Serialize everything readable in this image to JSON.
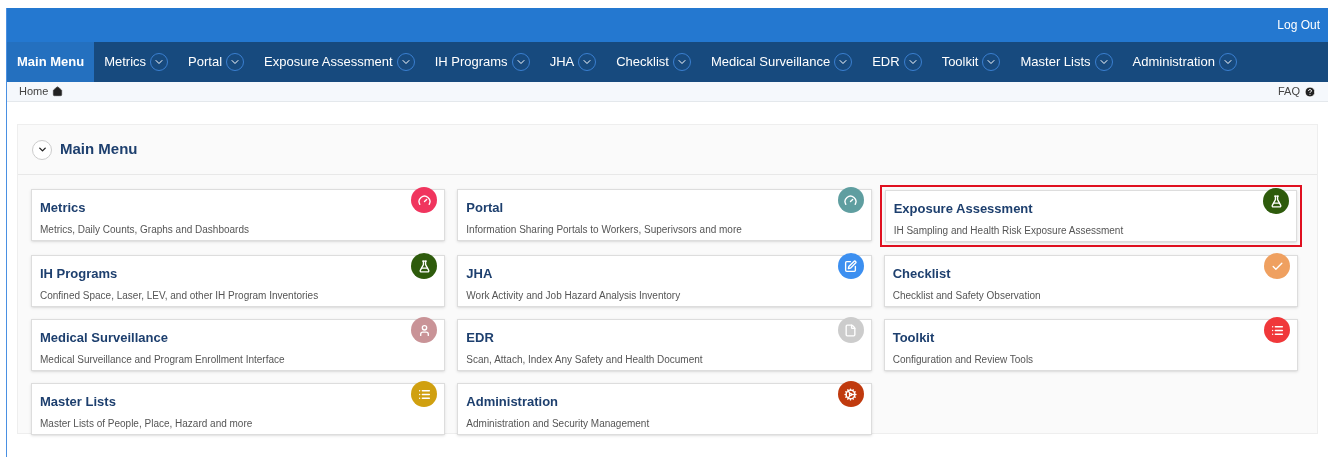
{
  "top_bar": {
    "logout": "Log Out"
  },
  "nav": [
    {
      "label": "Main Menu",
      "selected": true,
      "dropdown": false
    },
    {
      "label": "Metrics",
      "selected": false,
      "dropdown": true
    },
    {
      "label": "Portal",
      "selected": false,
      "dropdown": true
    },
    {
      "label": "Exposure Assessment",
      "selected": false,
      "dropdown": true
    },
    {
      "label": "IH Programs",
      "selected": false,
      "dropdown": true
    },
    {
      "label": "JHA",
      "selected": false,
      "dropdown": true
    },
    {
      "label": "Checklist",
      "selected": false,
      "dropdown": true
    },
    {
      "label": "Medical Surveillance",
      "selected": false,
      "dropdown": true
    },
    {
      "label": "EDR",
      "selected": false,
      "dropdown": true
    },
    {
      "label": "Toolkit",
      "selected": false,
      "dropdown": true
    },
    {
      "label": "Master Lists",
      "selected": false,
      "dropdown": true
    },
    {
      "label": "Administration",
      "selected": false,
      "dropdown": true
    }
  ],
  "breadcrumb": {
    "home": "Home",
    "faq": "FAQ"
  },
  "panel": {
    "title": "Main Menu",
    "expanded": true
  },
  "tiles": [
    {
      "title": "Metrics",
      "description": "Metrics, Daily Counts, Graphs and Dashboards",
      "kind": "gauge",
      "color": "#f0355e",
      "highlighted": false
    },
    {
      "title": "Portal",
      "description": "Information Sharing Portals to Workers, Superivsors and more",
      "kind": "gauge",
      "color": "#5f9ea0",
      "highlighted": false
    },
    {
      "title": "Exposure Assessment",
      "description": "IH Sampling and Health Risk Exposure Assessment",
      "kind": "flask",
      "color": "#2e5b0c",
      "highlighted": true
    },
    {
      "title": "IH Programs",
      "description": "Confined Space, Laser, LEV, and other IH Program Inventories",
      "kind": "flask",
      "color": "#2e5b0c",
      "highlighted": false
    },
    {
      "title": "JHA",
      "description": "Work Activity and Job Hazard Analysis Inventory",
      "kind": "edit",
      "color": "#3c8ff0",
      "highlighted": false
    },
    {
      "title": "Checklist",
      "description": "Checklist and Safety Observation",
      "kind": "check",
      "color": "#efa060",
      "highlighted": false
    },
    {
      "title": "Medical Surveillance",
      "description": "Medical Surveillance and Program Enrollment Interface",
      "kind": "user",
      "color": "#c99397",
      "highlighted": false
    },
    {
      "title": "EDR",
      "description": "Scan, Attach, Index Any Safety and Health Document",
      "kind": "file",
      "color": "#cccccc",
      "highlighted": false
    },
    {
      "title": "Toolkit",
      "description": "Configuration and Review Tools",
      "kind": "list",
      "color": "#f0383a",
      "highlighted": false
    },
    {
      "title": "Master Lists",
      "description": "Master Lists of People, Place, Hazard and more",
      "kind": "list",
      "color": "#d0a010",
      "highlighted": false
    },
    {
      "title": "Administration",
      "description": "Administration and Security Management",
      "kind": "cogs",
      "color": "#c03a0e",
      "highlighted": false
    }
  ]
}
